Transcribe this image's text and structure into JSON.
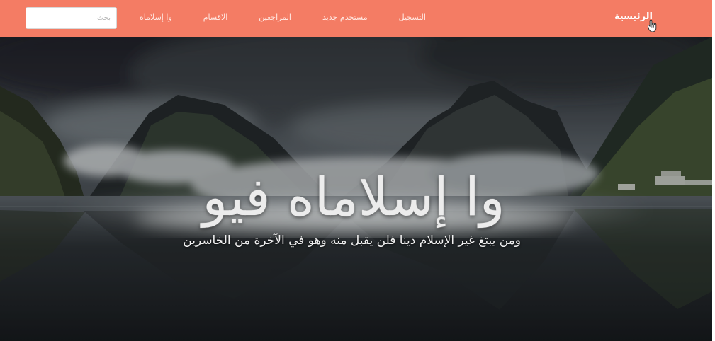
{
  "navbar": {
    "brand": "الرئيسية",
    "links": [
      "وا إسلاماه",
      "الاقسام",
      "المراجعين",
      "مستخدم جديد",
      "التسجيل"
    ],
    "search": {
      "placeholder": "بحث"
    },
    "color": "#f47c64"
  },
  "hero": {
    "title": "وا إسلاماه فيو",
    "subtitle": "ومن يبتغ غير الإسلام دينا فلن يقبل منه وهو في الآخرة من الخاسرين",
    "image": "misty-mountain-lake"
  }
}
